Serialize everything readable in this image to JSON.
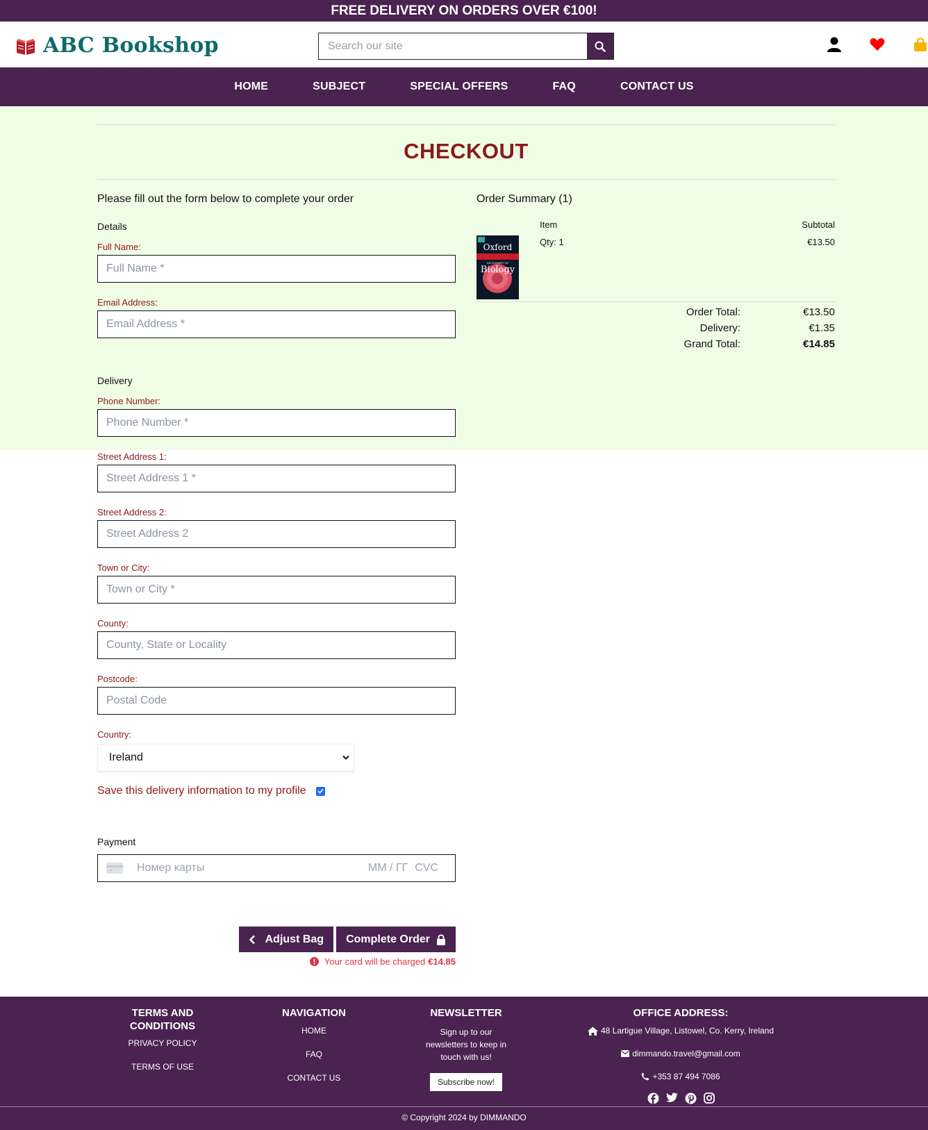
{
  "banner": {
    "text": "FREE DELIVERY ON ORDERS OVER €100!"
  },
  "header": {
    "logo_text": "ABC Bookshop",
    "search_placeholder": "Search our site"
  },
  "nav": {
    "items": [
      "HOME",
      "SUBJECT",
      "SPECIAL OFFERS",
      "FAQ",
      "CONTACT US"
    ]
  },
  "checkout": {
    "title": "CHECKOUT",
    "intro": "Please fill out the form below to complete your order",
    "details_heading": "Details",
    "delivery_heading": "Delivery",
    "payment_heading": "Payment",
    "fields": {
      "full_name": {
        "label": "Full Name:",
        "placeholder": "Full Name *"
      },
      "email": {
        "label": "Email Address:",
        "placeholder": "Email Address *"
      },
      "phone": {
        "label": "Phone Number:",
        "placeholder": "Phone Number *"
      },
      "street1": {
        "label": "Street Address 1:",
        "placeholder": "Street Address 1 *"
      },
      "street2": {
        "label": "Street Address 2:",
        "placeholder": "Street Address 2"
      },
      "town": {
        "label": "Town or City:",
        "placeholder": "Town or City *"
      },
      "county": {
        "label": "County:",
        "placeholder": "County, State or Locality"
      },
      "postcode": {
        "label": "Postcode:",
        "placeholder": "Postal Code"
      },
      "country": {
        "label": "Country:",
        "value": "Ireland"
      }
    },
    "save_info_label": "Save this delivery information to my profile",
    "save_info_checked": true,
    "card": {
      "number_placeholder": "Номер карты",
      "expiry_placeholder": "ММ / ГГ",
      "cvc_placeholder": "CVC"
    },
    "adjust_bag_label": "Adjust Bag",
    "complete_order_label": "Complete Order",
    "charge_text": "Your card will be charged",
    "charge_amount": "€14.85"
  },
  "summary": {
    "title": "Order Summary (1)",
    "item_header": "Item",
    "subtotal_header": "Subtotal",
    "item": {
      "cover_publisher": "Oxford",
      "cover_series": "DICTIONARY OF",
      "cover_subject": "Biology",
      "qty": "Qty: 1",
      "price": "€13.50"
    },
    "order_total_label": "Order Total:",
    "order_total": "€13.50",
    "delivery_label": "Delivery:",
    "delivery": "€1.35",
    "grand_total_label": "Grand Total:",
    "grand_total": "€14.85"
  },
  "footer": {
    "terms_heading": "TERMS AND CONDITIONS",
    "privacy": "PRIVACY POLICY",
    "terms_of_use": "TERMS OF USE",
    "nav_heading": "NAVIGATION",
    "nav_home": "HOME",
    "nav_faq": "FAQ",
    "nav_contact": "CONTACT US",
    "newsletter_heading": "NEWSLETTER",
    "newsletter_text": "Sign up to our newsletters to keep in touch with us!",
    "subscribe_label": "Subscribe now!",
    "office_heading": "OFFICE ADDRESS:",
    "address": "48 Lartigue Village, Listowel, Co. Kerry, Ireland",
    "email": "dimmando.travel@gmail.com",
    "phone": "+353 87 494 7086",
    "copyright": "© Copyright 2024 by DIMMANDO"
  },
  "colors": {
    "brand": "#4a2350",
    "accent": "#8b1a1a",
    "logo": "#0f6a6a",
    "background": "#f0fde6",
    "error": "#dc3545"
  }
}
